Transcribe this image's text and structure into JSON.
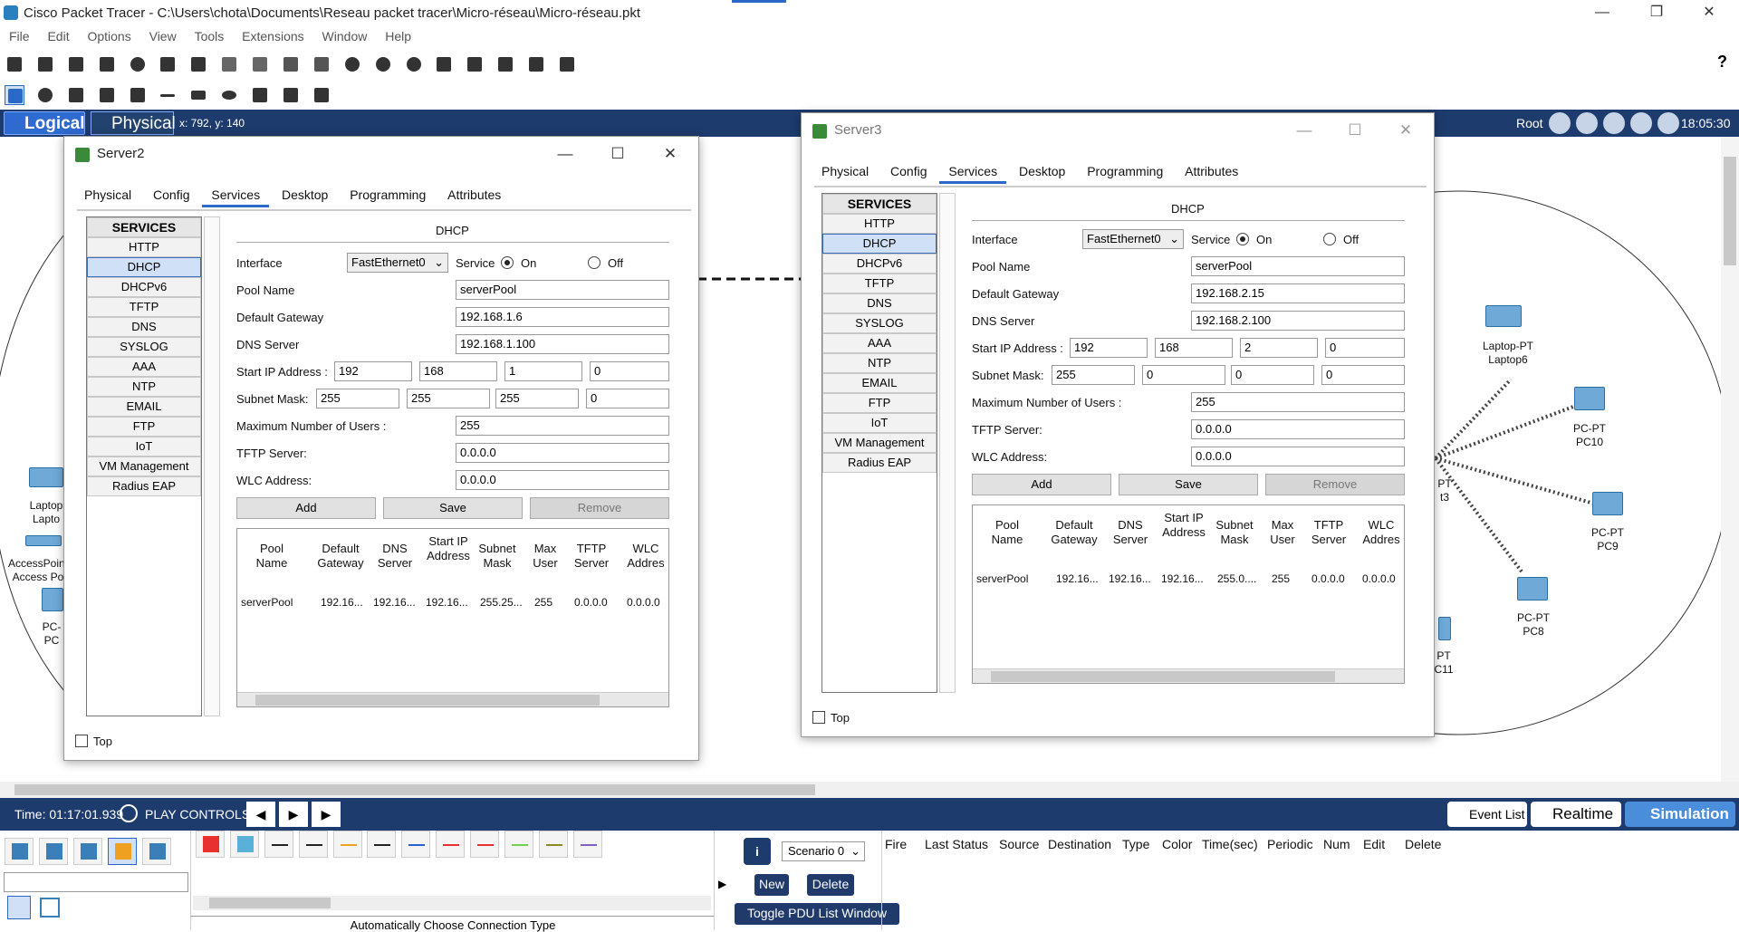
{
  "app": {
    "title": "Cisco Packet Tracer - C:\\Users\\chota\\Documents\\Reseau packet tracer\\Micro-réseau\\Micro-réseau.pkt",
    "menu": [
      "File",
      "Edit",
      "Options",
      "View",
      "Tools",
      "Extensions",
      "Window",
      "Help"
    ],
    "help": "?"
  },
  "nav": {
    "logical": "Logical",
    "physical": "Physical",
    "coords": "x: 792, y: 140",
    "root": "Root",
    "time": "18:05:30"
  },
  "server2": {
    "title": "Server2",
    "tabs": [
      "Physical",
      "Config",
      "Services",
      "Desktop",
      "Programming",
      "Attributes"
    ],
    "services_header": "SERVICES",
    "services": [
      "HTTP",
      "DHCP",
      "DHCPv6",
      "TFTP",
      "DNS",
      "SYSLOG",
      "AAA",
      "NTP",
      "EMAIL",
      "FTP",
      "IoT",
      "VM Management",
      "Radius EAP"
    ],
    "section": "DHCP",
    "interface_label": "Interface",
    "interface_value": "FastEthernet0",
    "service_label": "Service",
    "on_label": "On",
    "off_label": "Off",
    "pool_name_label": "Pool Name",
    "pool_name": "serverPool",
    "gateway_label": "Default Gateway",
    "gateway": "192.168.1.6",
    "dns_label": "DNS Server",
    "dns": "192.168.1.100",
    "start_ip_label": "Start IP Address :",
    "start_ip": [
      "192",
      "168",
      "1",
      "0"
    ],
    "subnet_label": "Subnet Mask:",
    "subnet": [
      "255",
      "255",
      "255",
      "0"
    ],
    "max_users_label": "Maximum Number of Users :",
    "max_users": "255",
    "tftp_label": "TFTP Server:",
    "tftp": "0.0.0.0",
    "wlc_label": "WLC Address:",
    "wlc": "0.0.0.0",
    "add": "Add",
    "save": "Save",
    "remove": "Remove",
    "columns": [
      "Pool Name",
      "Default Gateway",
      "DNS Server",
      "Start IP Address",
      "Subnet Mask",
      "Max User",
      "TFTP Server",
      "WLC Addres"
    ],
    "row": [
      "serverPool",
      "192.16...",
      "192.16...",
      "192.16...",
      "255.25...",
      "255",
      "0.0.0.0",
      "0.0.0.0"
    ],
    "top_label": "Top"
  },
  "server3": {
    "title": "Server3",
    "tabs": [
      "Physical",
      "Config",
      "Services",
      "Desktop",
      "Programming",
      "Attributes"
    ],
    "services_header": "SERVICES",
    "services": [
      "HTTP",
      "DHCP",
      "DHCPv6",
      "TFTP",
      "DNS",
      "SYSLOG",
      "AAA",
      "NTP",
      "EMAIL",
      "FTP",
      "IoT",
      "VM Management",
      "Radius EAP"
    ],
    "section": "DHCP",
    "interface_label": "Interface",
    "interface_value": "FastEthernet0",
    "service_label": "Service",
    "on_label": "On",
    "off_label": "Off",
    "pool_name_label": "Pool Name",
    "pool_name": "serverPool",
    "gateway_label": "Default Gateway",
    "gateway": "192.168.2.15",
    "dns_label": "DNS Server",
    "dns": "192.168.2.100",
    "start_ip_label": "Start IP Address :",
    "start_ip": [
      "192",
      "168",
      "2",
      "0"
    ],
    "subnet_label": "Subnet Mask:",
    "subnet": [
      "255",
      "0",
      "0",
      "0"
    ],
    "max_users_label": "Maximum Number of Users :",
    "max_users": "255",
    "tftp_label": "TFTP Server:",
    "tftp": "0.0.0.0",
    "wlc_label": "WLC Address:",
    "wlc": "0.0.0.0",
    "add": "Add",
    "save": "Save",
    "remove": "Remove",
    "columns": [
      "Pool Name",
      "Default Gateway",
      "DNS Server",
      "Start IP Address",
      "Subnet Mask",
      "Max User",
      "TFTP Server",
      "WLC Addres"
    ],
    "row": [
      "serverPool",
      "192.16...",
      "192.16...",
      "192.16...",
      "255.0....",
      "255",
      "0.0.0.0",
      "0.0.0.0"
    ],
    "top_label": "Top"
  },
  "devices": {
    "laptop6": [
      "Laptop-PT",
      "Laptop6"
    ],
    "pc10": [
      "PC-PT",
      "PC10"
    ],
    "pc9": [
      "PC-PT",
      "PC9"
    ],
    "pc8": [
      "PC-PT",
      "PC8"
    ],
    "pc11": [
      "PT",
      "C11"
    ],
    "pt3": [
      "PT",
      "t3"
    ],
    "left_laptop": [
      "Laptop",
      "Lapto"
    ],
    "left_ap": [
      "AccessPoint",
      "Access Po"
    ],
    "left_pc": [
      "PC-",
      "PC"
    ]
  },
  "sim": {
    "time": "Time: 01:17:01.939",
    "play_controls": "PLAY CONTROLS:",
    "event_list": "Event List",
    "realtime": "Realtime",
    "simulation": "Simulation"
  },
  "pdu": {
    "scenario": "Scenario 0",
    "new": "New",
    "delete": "Delete",
    "toggle": "Toggle PDU List Window",
    "columns": [
      "Fire",
      "Last Status",
      "Source",
      "Destination",
      "Type",
      "Color",
      "Time(sec)",
      "Periodic",
      "Num",
      "Edit",
      "Delete"
    ]
  },
  "connection_hint": "Automatically Choose Connection Type",
  "colors": {
    "navbar": "#1e3b6e",
    "accent": "#2b69c9"
  }
}
